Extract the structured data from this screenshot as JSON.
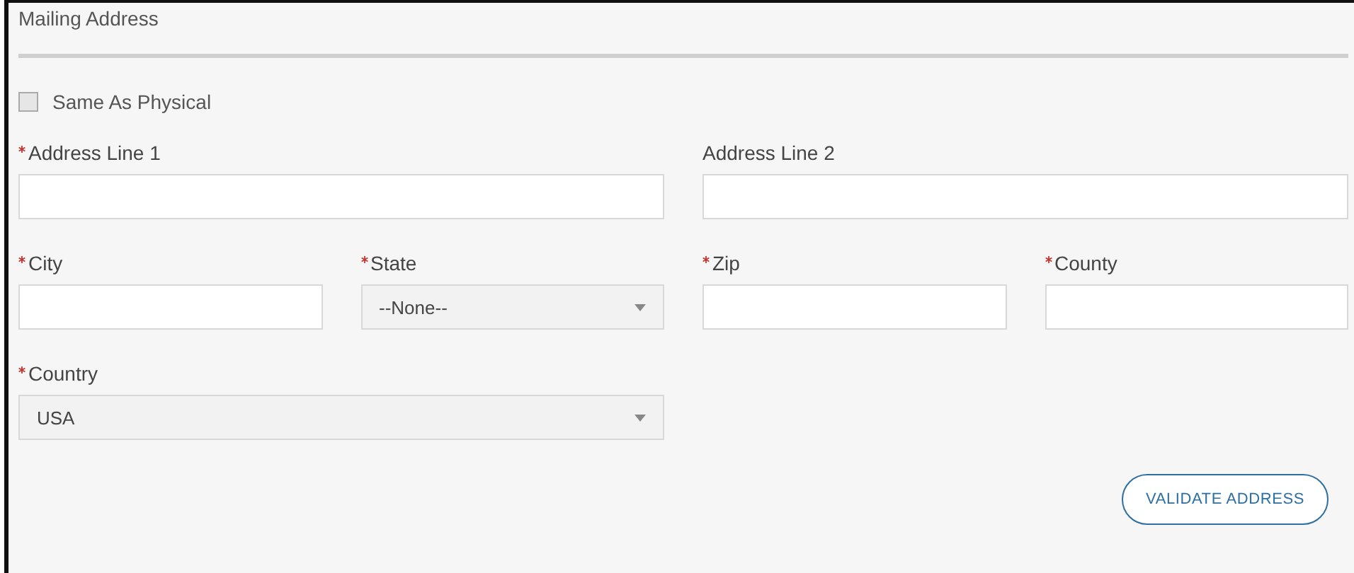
{
  "section": {
    "title": "Mailing Address"
  },
  "same_as_physical": {
    "label": "Same As Physical",
    "checked": false
  },
  "rows": [
    [
      {
        "kind": "text",
        "label": "Address Line 1",
        "required": true
      },
      {
        "kind": "text",
        "label": "Address Line 2",
        "required": false
      }
    ],
    [
      {
        "kind": "text",
        "label": "City",
        "required": true
      },
      {
        "kind": "select",
        "label": "State",
        "required": true,
        "value": "--None--"
      },
      {
        "kind": "text",
        "label": "Zip",
        "required": true
      },
      {
        "kind": "text",
        "label": "County",
        "required": true
      }
    ],
    [
      {
        "kind": "select",
        "label": "Country",
        "required": true,
        "value": "USA"
      }
    ]
  ],
  "button": {
    "label": "VALIDATE ADDRESS"
  }
}
